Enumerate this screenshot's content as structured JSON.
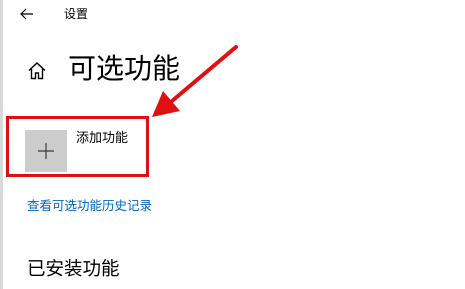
{
  "window": {
    "title": "设置",
    "back_icon": "arrow-left-icon"
  },
  "page": {
    "home_icon": "home-icon",
    "title": "可选功能"
  },
  "add_feature": {
    "icon": "plus-icon",
    "label": "添加功能"
  },
  "history_link": {
    "label": "查看可选功能历史记录",
    "color": "#0067c0"
  },
  "installed": {
    "heading": "已安装功能"
  },
  "annotation": {
    "color": "#e01010"
  }
}
